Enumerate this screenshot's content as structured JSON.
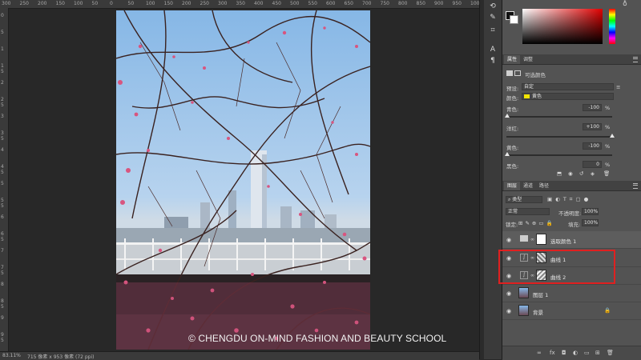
{
  "rulers": {
    "top_ticks": [
      "300",
      "250",
      "200",
      "150",
      "100",
      "50",
      "0",
      "50",
      "100",
      "150",
      "200",
      "250",
      "300",
      "350",
      "400",
      "450",
      "500",
      "550",
      "600",
      "650",
      "700",
      "750",
      "800",
      "850",
      "900",
      "950",
      "1000"
    ],
    "left_ticks": [
      "0",
      "5",
      "1",
      "1 5",
      "2",
      "2 5",
      "3",
      "3 5",
      "4",
      "4 5",
      "5",
      "5 5",
      "6",
      "6 5",
      "7",
      "7 5",
      "8",
      "8 5",
      "9",
      "9 5"
    ]
  },
  "status": {
    "zoom": "83.11%",
    "doc_info": "715 像素 x 953 像素 (72 ppi)"
  },
  "watermark": "© CHENGDU ON-MIND FASHION AND BEAUTY SCHOOL",
  "properties": {
    "tabs": [
      "属性",
      "调整"
    ],
    "adjustment_title": "可选颜色",
    "preset_label": "预设:",
    "preset_value": "自定",
    "color_label": "颜色:",
    "color_value": "黄色",
    "color_swatch": "#f2e400",
    "sliders": [
      {
        "label": "青色:",
        "value": "-100",
        "unit": "%",
        "level": 0.0
      },
      {
        "label": "洋红:",
        "value": "+100",
        "unit": "%",
        "level": 1.0
      },
      {
        "label": "黄色:",
        "value": "-100",
        "unit": "%",
        "level": 0.0
      },
      {
        "label": "黑色:",
        "value": "0",
        "unit": "%",
        "level": 0.5
      }
    ]
  },
  "layers_panel": {
    "tabs": [
      "图层",
      "通道",
      "路径"
    ],
    "filter_label": "类型",
    "blend_mode": "正常",
    "opacity_label": "不透明度:",
    "opacity_value": "100%",
    "lock_label": "锁定:",
    "fill_label": "填充:",
    "fill_value": "100%",
    "layers": [
      {
        "name": "选取颜色 1",
        "kind": "adjustment",
        "selected": true
      },
      {
        "name": "曲线 1",
        "kind": "curves",
        "selected": false
      },
      {
        "name": "曲线 2",
        "kind": "curves",
        "selected": false
      },
      {
        "name": "图层 1",
        "kind": "pixel",
        "selected": false
      },
      {
        "name": "背景",
        "kind": "background",
        "selected": false
      }
    ],
    "bottom_icons": [
      "link-icon",
      "fx-icon",
      "mask-icon",
      "adjustment-icon",
      "group-icon",
      "new-layer-icon",
      "trash-icon"
    ]
  },
  "colors": {
    "highlight": "#e02020",
    "picker_red": "#e00000"
  }
}
